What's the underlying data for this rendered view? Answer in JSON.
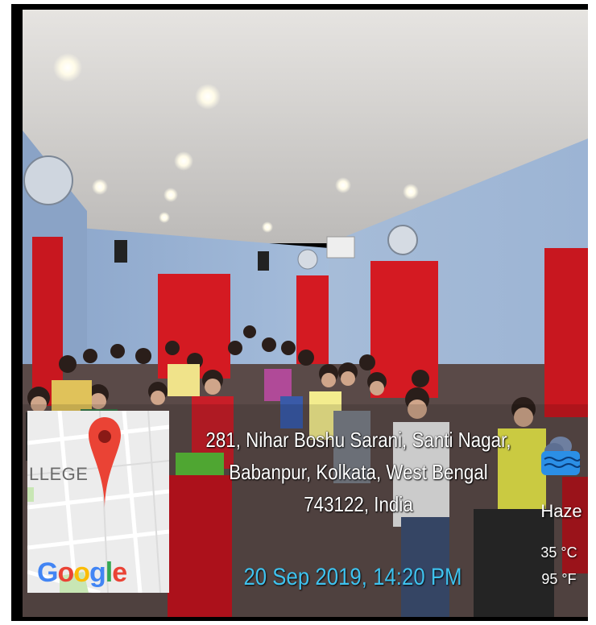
{
  "overlay": {
    "address_line1": "281, Nihar Boshu Sarani, Santi Nagar,",
    "address_line2": "Babanpur, Kolkata, West Bengal",
    "address_line3": "743122, India",
    "timestamp": "20 Sep 2019, 14:20 PM",
    "weather": "Haze",
    "temp_c": "35 °C",
    "temp_f": "95 °F",
    "weather_icon": "rain-cloud-icon"
  },
  "map": {
    "label": "LLEGE",
    "brand": "Google",
    "pin_icon": "map-pin-icon"
  },
  "colors": {
    "timestamp": "#3fc2ee",
    "pin": "#ea4335",
    "wall": "#9fb8d8",
    "curtain": "#d41a22"
  }
}
